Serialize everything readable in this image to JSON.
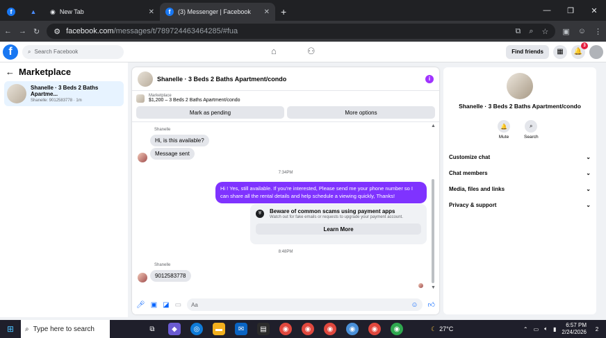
{
  "browser": {
    "tabs": [
      {
        "label": ""
      },
      {
        "label": ""
      },
      {
        "label": "New Tab"
      },
      {
        "label": "(3) Messenger | Facebook"
      }
    ],
    "url_host": "facebook.com",
    "url_path": "/messages/t/789724463464285/#fua",
    "icons": [
      "back-icon",
      "forward-icon",
      "reload-icon",
      "site-info-icon",
      "install-icon",
      "zoom-icon",
      "bookmark-icon",
      "tab-search-icon",
      "profile-icon",
      "menu-icon"
    ]
  },
  "fb": {
    "search_placeholder": "Search Facebook",
    "find_friends": "Find friends",
    "notification_count": "3"
  },
  "left": {
    "header": "Marketplace",
    "conversation": {
      "title": "Shanelle · 3 Beds 2 Baths Apartme...",
      "subtitle": "Shanelle: 9012583778 · 1m"
    }
  },
  "chat": {
    "title": "Shanelle · 3 Beds 2 Baths Apartment/condo",
    "listing_source": "Marketplace",
    "listing_price": "$1,200 – 3 Beds 2 Baths Apartment/condo",
    "mark_pending": "Mark as pending",
    "more_options": "More options",
    "sender_name_1": "Shanelle",
    "msg_1": "Hi, is this available?",
    "msg_2": "Message sent",
    "time_1": "7:34PM",
    "reply": "Hi ! Yes, still available. If you're interested, Please send me your phone number so I can share all the rental details and help schedule a viewing quickly, Thanks!",
    "scam_title": "Beware of common scams using payment apps",
    "scam_sub": "Watch out for fake emails or requests to upgrade your payment account.",
    "learn_more": "Learn More",
    "time_2": "8:48PM",
    "sender_name_2": "Shanelle",
    "msg_3": "9012583778",
    "composer_placeholder": "Aa"
  },
  "right": {
    "title": "Shanelle · 3 Beds 2 Baths Apartment/condo",
    "mute": "Mute",
    "search": "Search",
    "items": [
      "Customize chat",
      "Chat members",
      "Media, files and links",
      "Privacy & support"
    ]
  },
  "taskbar": {
    "search_placeholder": "Type here to search",
    "weather": "27°C",
    "time": "6:57 PM",
    "date": "2/24/2026",
    "notif_count": "2"
  }
}
